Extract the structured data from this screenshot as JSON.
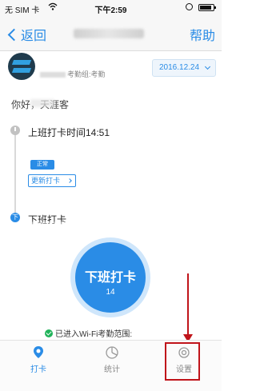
{
  "status_bar": {
    "carrier": "无 SIM 卡",
    "time": "下午2:59"
  },
  "nav": {
    "back_label": "返回",
    "help_label": "帮助"
  },
  "header": {
    "group_text": "考勤组:考勤",
    "date": "2016.12.24"
  },
  "greeting": "你好，天涯客",
  "timeline": {
    "checkin_label": "上班打卡时间14:51",
    "status_badge": "正常",
    "update_button": "更新打卡",
    "checkout_marker": "下",
    "checkout_label": "下班打卡"
  },
  "main_button": {
    "label": "下班打卡",
    "time": "14"
  },
  "wifi_status": "已进入Wi-Fi考勤范围:",
  "tabs": [
    {
      "label": "打卡",
      "icon": "location-pin-icon",
      "active": true
    },
    {
      "label": "统计",
      "icon": "stats-icon",
      "active": false
    },
    {
      "label": "设置",
      "icon": "gear-icon",
      "active": false
    }
  ],
  "colors": {
    "accent": "#2a8ce6",
    "annotation": "#c0141a",
    "success": "#21b35a"
  }
}
